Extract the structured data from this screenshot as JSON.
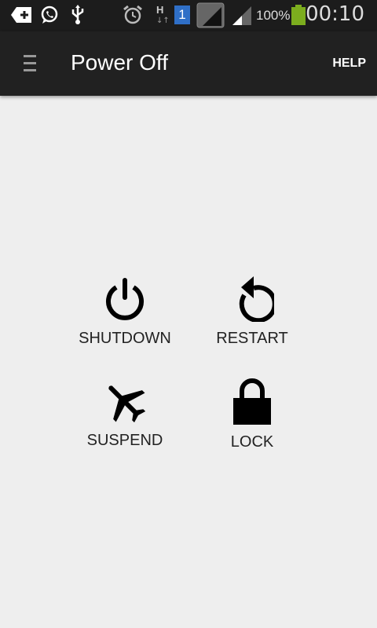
{
  "status_bar": {
    "icons": [
      "notification-add-icon",
      "whatsapp-icon",
      "usb-icon",
      "alarm-icon",
      "hspa-data-icon",
      "sim-1-icon",
      "signal-icon",
      "signal-icon",
      "battery-icon"
    ],
    "sim_label": "1",
    "data_type": "H",
    "battery_percent": "100%",
    "battery_color": "#7cad1e",
    "time": "00:10"
  },
  "app_bar": {
    "title": "Power Off",
    "help_label": "HELP",
    "menu_icon": "drawer-menu-icon"
  },
  "actions": [
    {
      "label": "SHUTDOWN",
      "icon": "power-icon"
    },
    {
      "label": "RESTART",
      "icon": "restart-icon"
    },
    {
      "label": "SUSPEND",
      "icon": "airplane-icon"
    },
    {
      "label": "LOCK",
      "icon": "lock-icon"
    }
  ]
}
